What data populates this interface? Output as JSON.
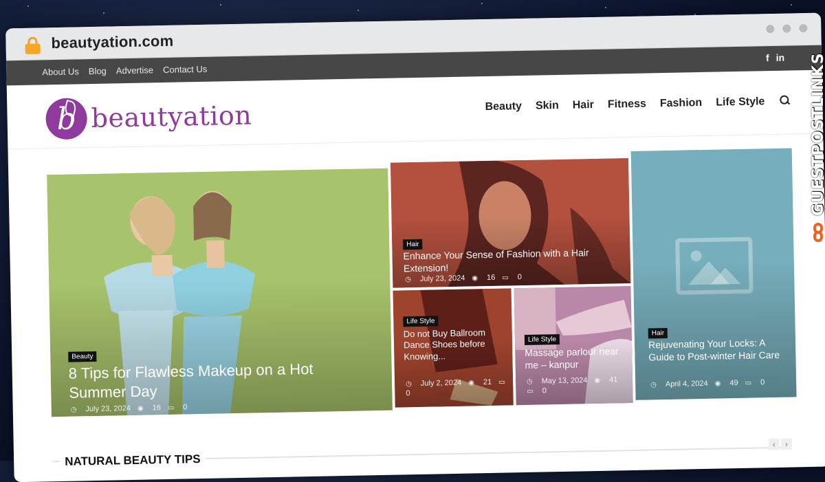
{
  "browser": {
    "url": "beautyation.com"
  },
  "topbar": {
    "links": [
      "About Us",
      "Blog",
      "Advertise",
      "Contact Us"
    ],
    "social": [
      "f",
      "in"
    ]
  },
  "header": {
    "logo_text": "beautyation",
    "nav": [
      "Beauty",
      "Skin",
      "Hair",
      "Fitness",
      "Fashion",
      "Life Style"
    ]
  },
  "posts": [
    {
      "category": "Beauty",
      "title": "8 Tips for Flawless Makeup on a Hot Summer Day",
      "date": "July 23, 2024",
      "views": "16",
      "comments": "0"
    },
    {
      "category": "Hair",
      "title": "Enhance Your Sense of Fashion with a Hair Extension!",
      "date": "July 23, 2024",
      "views": "16",
      "comments": "0"
    },
    {
      "category": "Life Style",
      "title": "Do not Buy Ballroom Dance Shoes before Knowing...",
      "date": "July 2, 2024",
      "views": "21",
      "comments": "0"
    },
    {
      "category": "Life Style",
      "title": "Massage parlour near me – kanpur",
      "date": "May 13, 2024",
      "views": "41",
      "comments": "0"
    },
    {
      "category": "Hair",
      "title": "Rejuvenating Your Locks: A Guide to Post-winter Hair Care",
      "date": "April 4, 2024",
      "views": "49",
      "comments": "0"
    }
  ],
  "section": {
    "title": "NATURAL BEAUTY TIPS",
    "prev": "‹",
    "next": "›"
  },
  "watermark": {
    "text": "GUESTPOSTLINKS"
  },
  "colors": {
    "brand": "#8f3b9d",
    "topbar": "#474747",
    "watermark_accent": "#f26322"
  }
}
